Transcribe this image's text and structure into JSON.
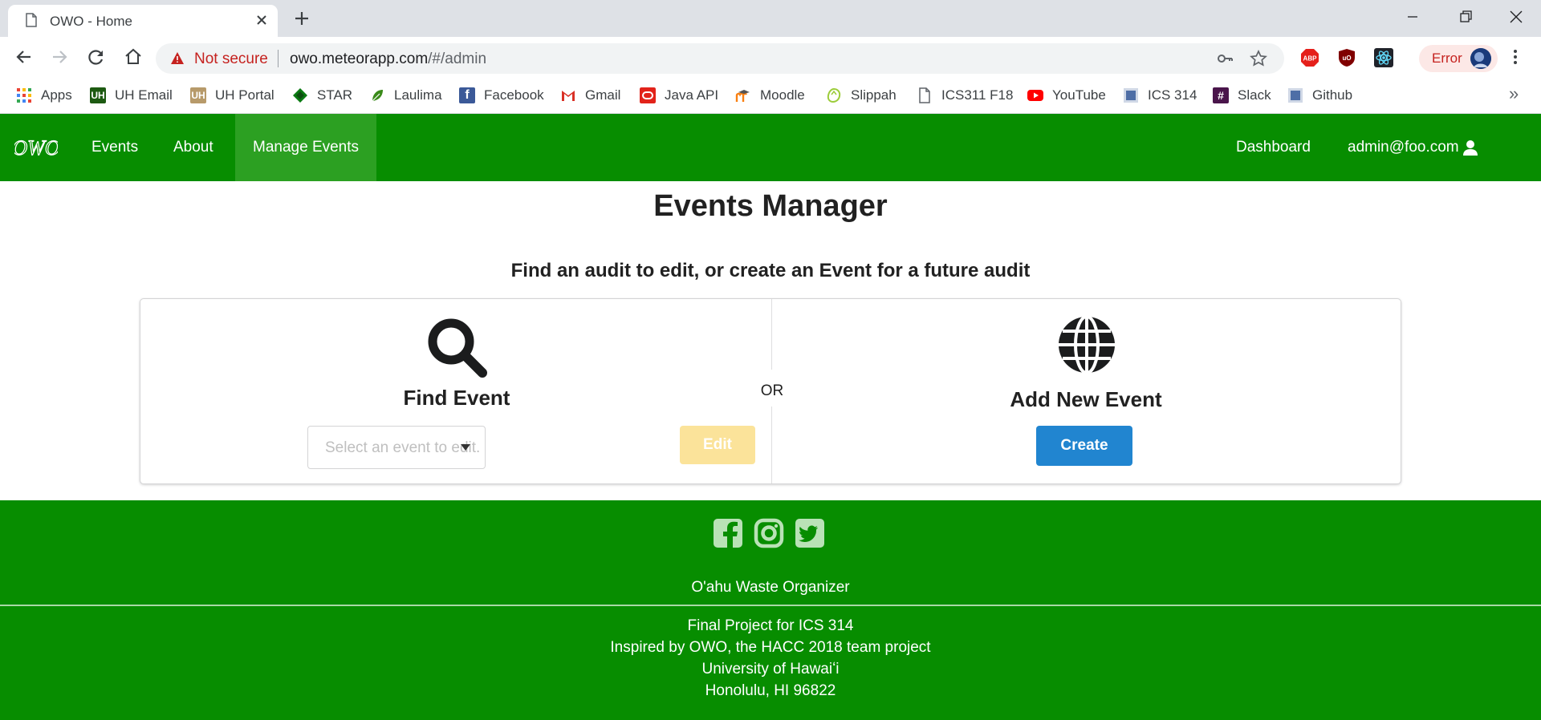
{
  "browser": {
    "tab_title": "OWO - Home",
    "security_label": "Not secure",
    "url_host": "owo.meteorapp.com",
    "url_path": "/#/admin",
    "error_label": "Error"
  },
  "bookmarks": [
    {
      "label": "Apps",
      "icon": "apps-grid-icon"
    },
    {
      "label": "UH Email",
      "icon": "uh-icon"
    },
    {
      "label": "UH Portal",
      "icon": "uh-icon"
    },
    {
      "label": "STAR",
      "icon": "star-diamond-icon"
    },
    {
      "label": "Laulima",
      "icon": "leaf-icon"
    },
    {
      "label": "Facebook",
      "icon": "facebook-icon"
    },
    {
      "label": "Gmail",
      "icon": "gmail-icon"
    },
    {
      "label": "Java API",
      "icon": "oracle-icon"
    },
    {
      "label": "Moodle",
      "icon": "moodle-icon"
    },
    {
      "label": "Slippah",
      "icon": "slippah-icon"
    },
    {
      "label": "ICS311 F18",
      "icon": "document-icon"
    },
    {
      "label": "YouTube",
      "icon": "youtube-icon"
    },
    {
      "label": "ICS 314",
      "icon": "square-icon"
    },
    {
      "label": "Slack",
      "icon": "slack-icon"
    },
    {
      "label": "Github",
      "icon": "square-icon"
    }
  ],
  "nav": {
    "items": [
      "Events",
      "About",
      "Manage Events"
    ],
    "active": "Manage Events",
    "dashboard": "Dashboard",
    "user": "admin@foo.com"
  },
  "main": {
    "title": "Events Manager",
    "subtitle": "Find an audit to edit, or create an Event for a future audit",
    "find_heading": "Find Event",
    "find_placeholder": "Select an event to edit.",
    "edit_label": "Edit",
    "or_label": "OR",
    "add_heading": "Add New Event",
    "create_label": "Create"
  },
  "footer": {
    "org": "O'ahu Waste Organizer",
    "lines": [
      "Final Project for ICS 314",
      "Inspired by OWO, the HACC 2018 team project",
      "University of Hawaiʻi",
      "Honolulu, HI 96822"
    ]
  },
  "colors": {
    "nav_green": "#078d00",
    "active_nav": "#2ca022",
    "edit_button": "#fbe39a",
    "create_button": "#2185d0"
  }
}
